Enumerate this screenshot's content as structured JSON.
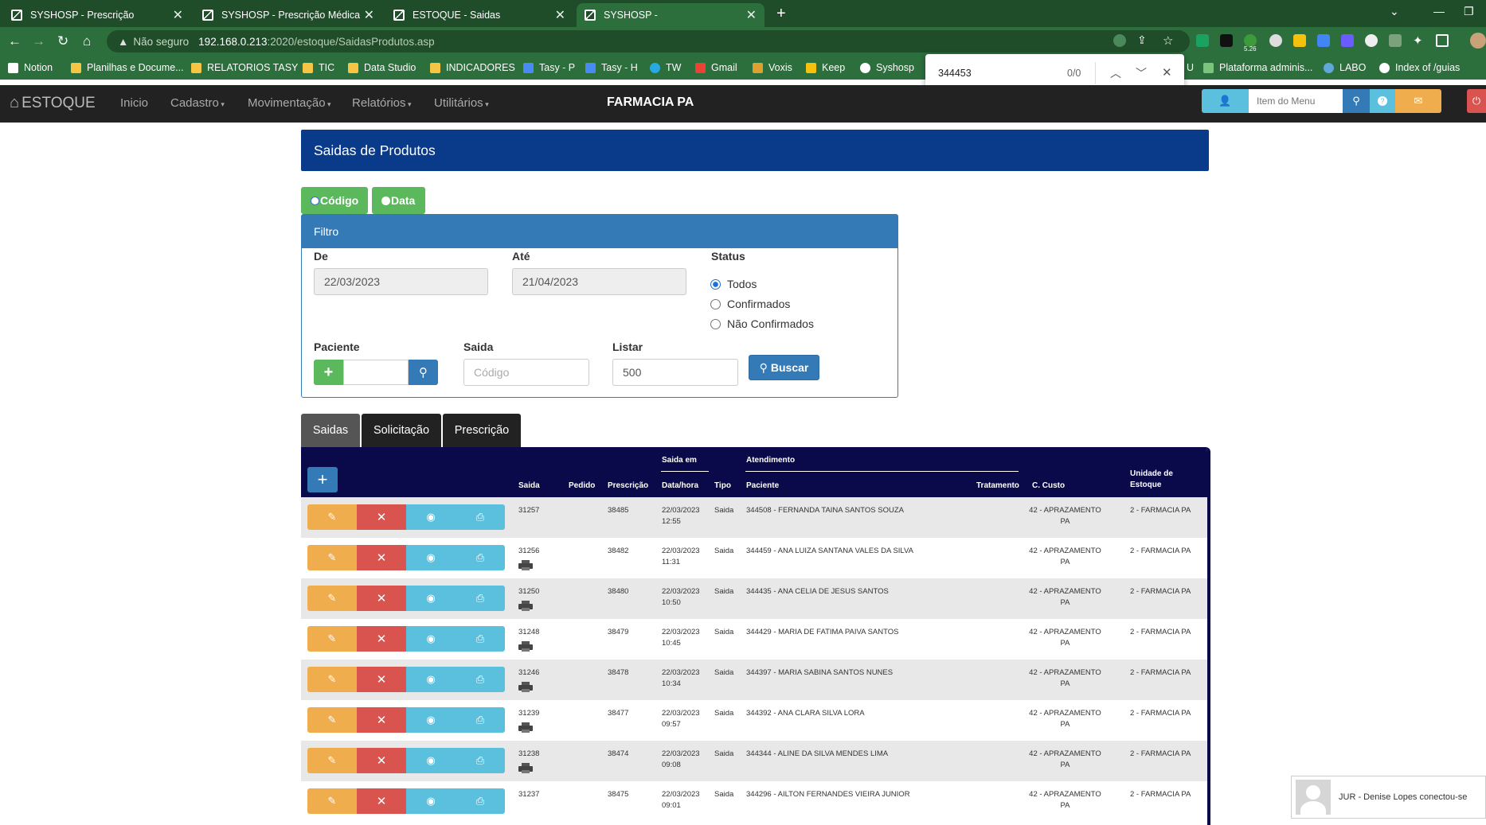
{
  "browser": {
    "tabs": [
      {
        "title": "SYSHOSP - Prescrição"
      },
      {
        "title": "SYSHOSP - Prescrição Médica"
      },
      {
        "title": "ESTOQUE - Saidas"
      },
      {
        "title": "SYSHOSP -"
      }
    ],
    "address": {
      "security_label": "Não seguro",
      "host": "192.168.0.213",
      "path": ":2020/estoque/SaidasProdutos.asp"
    },
    "ext_badge": "5.26",
    "bookmarks": [
      {
        "label": "Notion"
      },
      {
        "label": "Planilhas e Docume..."
      },
      {
        "label": "RELATORIOS TASY"
      },
      {
        "label": "TIC"
      },
      {
        "label": "Data Studio"
      },
      {
        "label": "INDICADORES"
      },
      {
        "label": "Tasy - P"
      },
      {
        "label": "Tasy - H"
      },
      {
        "label": "TW"
      },
      {
        "label": "Gmail"
      },
      {
        "label": "Voxis"
      },
      {
        "label": "Keep"
      },
      {
        "label": "Syshosp"
      },
      {
        "label": "U"
      },
      {
        "label": "Plataforma adminis..."
      },
      {
        "label": "LABO"
      },
      {
        "label": "Index of /guias"
      }
    ],
    "find": {
      "query": "344453",
      "count": "0/0"
    }
  },
  "app": {
    "brand": "ESTOQUE",
    "menu": [
      "Inicio",
      "Cadastro",
      "Movimentação",
      "Relatórios",
      "Utilitários"
    ],
    "pharmacy": "FARMACIA PA",
    "search_placeholder": "Item do Menu"
  },
  "page": {
    "title": "Saidas de Produtos",
    "toggle": {
      "code": "Código",
      "date": "Data"
    },
    "filter": {
      "title": "Filtro",
      "from_label": "De",
      "from_value": "22/03/2023",
      "to_label": "Até",
      "to_value": "21/04/2023",
      "status_label": "Status",
      "status_options": [
        "Todos",
        "Confirmados",
        "Não Confirmados"
      ],
      "patient_label": "Paciente",
      "exit_label": "Saida",
      "exit_placeholder": "Código",
      "list_label": "Listar",
      "list_value": "500",
      "search_button": "Buscar"
    },
    "tabs": [
      "Saidas",
      "Solicitação",
      "Prescrição"
    ],
    "table": {
      "group_saida_em": "Saida em",
      "group_atendimento": "Atendimento",
      "columns": {
        "saida": "Saida",
        "pedido": "Pedido",
        "prescricao": "Prescrição",
        "datahora": "Data/hora",
        "tipo": "Tipo",
        "paciente": "Paciente",
        "tratamento": "Tratamento",
        "custo": "C. Custo",
        "unidade_l1": "Unidade de",
        "unidade_l2": "Estoque"
      },
      "rows": [
        {
          "saida": "31257",
          "pedido": "",
          "prescricao": "38485",
          "data": "22/03/2023",
          "hora": "12:55",
          "tipo": "Saida",
          "paciente": "344508 - FERNANDA TAINA SANTOS SOUZA",
          "tratamento": "",
          "custo1": "42 - APRAZAMENTO",
          "custo2": "PA",
          "unidade": "2 - FARMACIA PA",
          "printer": false
        },
        {
          "saida": "31256",
          "pedido": "",
          "prescricao": "38482",
          "data": "22/03/2023",
          "hora": "11:31",
          "tipo": "Saida",
          "paciente": "344459 - ANA LUIZA SANTANA VALES DA SILVA",
          "tratamento": "",
          "custo1": "42 - APRAZAMENTO",
          "custo2": "PA",
          "unidade": "2 - FARMACIA PA",
          "printer": true
        },
        {
          "saida": "31250",
          "pedido": "",
          "prescricao": "38480",
          "data": "22/03/2023",
          "hora": "10:50",
          "tipo": "Saida",
          "paciente": "344435 - ANA CELIA DE JESUS SANTOS",
          "tratamento": "",
          "custo1": "42 - APRAZAMENTO",
          "custo2": "PA",
          "unidade": "2 - FARMACIA PA",
          "printer": true
        },
        {
          "saida": "31248",
          "pedido": "",
          "prescricao": "38479",
          "data": "22/03/2023",
          "hora": "10:45",
          "tipo": "Saida",
          "paciente": "344429 - MARIA DE FATIMA PAIVA SANTOS",
          "tratamento": "",
          "custo1": "42 - APRAZAMENTO",
          "custo2": "PA",
          "unidade": "2 - FARMACIA PA",
          "printer": true
        },
        {
          "saida": "31246",
          "pedido": "",
          "prescricao": "38478",
          "data": "22/03/2023",
          "hora": "10:34",
          "tipo": "Saida",
          "paciente": "344397 - MARIA SABINA SANTOS NUNES",
          "tratamento": "",
          "custo1": "42 - APRAZAMENTO",
          "custo2": "PA",
          "unidade": "2 - FARMACIA PA",
          "printer": true
        },
        {
          "saida": "31239",
          "pedido": "",
          "prescricao": "38477",
          "data": "22/03/2023",
          "hora": "09:57",
          "tipo": "Saida",
          "paciente": "344392 - ANA CLARA SILVA LORA",
          "tratamento": "",
          "custo1": "42 - APRAZAMENTO",
          "custo2": "PA",
          "unidade": "2 - FARMACIA PA",
          "printer": true
        },
        {
          "saida": "31238",
          "pedido": "",
          "prescricao": "38474",
          "data": "22/03/2023",
          "hora": "09:08",
          "tipo": "Saida",
          "paciente": "344344 - ALINE DA SILVA MENDES LIMA",
          "tratamento": "",
          "custo1": "42 - APRAZAMENTO",
          "custo2": "PA",
          "unidade": "2 - FARMACIA PA",
          "printer": true
        },
        {
          "saida": "31237",
          "pedido": "",
          "prescricao": "38475",
          "data": "22/03/2023",
          "hora": "09:01",
          "tipo": "Saida",
          "paciente": "344296 - AILTON FERNANDES VIEIRA JUNIOR",
          "tratamento": "",
          "custo1": "42 - APRAZAMENTO",
          "custo2": "PA",
          "unidade": "2 - FARMACIA PA",
          "printer": false
        }
      ]
    }
  },
  "notification": {
    "text": "JUR - Denise Lopes conectou-se"
  },
  "colors": {
    "browser_green": "#2c6e3c",
    "navbar": "#222222",
    "panel_blue": "#0a3a8a",
    "table_head": "#0a0a4a",
    "success": "#5cb85c",
    "warning": "#f0ad4e",
    "danger": "#d9534f",
    "info": "#5bc0de",
    "primary": "#337ab7"
  }
}
